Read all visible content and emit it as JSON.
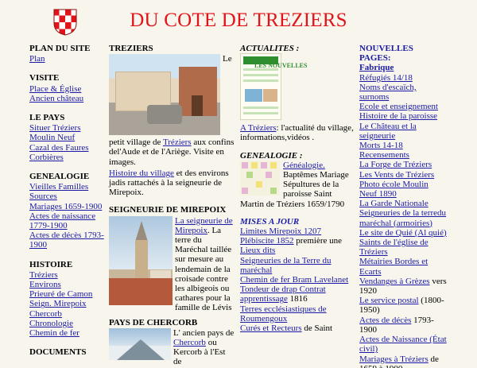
{
  "header": {
    "title": "DU COTE DE TREZIERS",
    "shield_colors": [
      "#e0141b",
      "#ffffff"
    ]
  },
  "col1": {
    "plan": {
      "heading": "PLAN DU SITE",
      "links": [
        "Plan"
      ]
    },
    "visite": {
      "heading": "VISITE",
      "links": [
        "Place & Église",
        "Ancien château"
      ]
    },
    "pays": {
      "heading": "LE PAYS",
      "links": [
        "Situer Tréziers",
        "Moulin Neuf",
        "Cazal des Faures",
        "Corbières"
      ]
    },
    "genealogie": {
      "heading": "GENEALOGIE",
      "links": [
        "Vieilles Familles",
        "Sources",
        "Mariages 1659-1900",
        "Actes de naissance 1779-1900",
        "Actes de décès 1793-1900"
      ]
    },
    "histoire": {
      "heading": "HISTOIRE",
      "links": [
        "Tréziers",
        "Environs",
        "Prieuré de Camon",
        "Seign. Mirepoix",
        "Chercorb",
        "Chronologie",
        "Chemin de fer"
      ]
    },
    "documents": {
      "heading": "DOCUMENTS"
    }
  },
  "col2": {
    "treziers": {
      "heading": "TREZIERS",
      "text_le": "Le",
      "text_petit": "petit village de",
      "link_treziers": "Tréziers",
      "text_confins": "aux confins del'Aude et de l'Ariège. Visite en images.",
      "link_histoire": "Histoire du village",
      "text_environs": "et des environs jadis rattachés à la seigneurie de Mirepoix."
    },
    "seigneurie": {
      "heading": "SEIGNEURIE DE MIREPOIX",
      "link": "La seigneurie de Mirepoix",
      "text": ". La terre du Maréchal taillée sur mesure au lendemain de la croisade contre les albigeois ou cathares pour la famille de Lévis"
    },
    "chercorb": {
      "heading": "PAYS DE CHERCORB",
      "text_1": "L' ancien pays de",
      "link": "Chercorb",
      "text_2": "ou Kercorb à l'Est de"
    }
  },
  "col3": {
    "actualites": {
      "heading": "ACTUALITES :",
      "news_label": "LES NOUVELLES",
      "link": "A Tréziers",
      "text": ": l'actualité du village, informations,vidéos ."
    },
    "genealogie": {
      "heading": "GENEALOGIE :",
      "link": "Généalogie.",
      "text": "Baptêmes Mariage Sépultures de la paroisse Saint Martin de Tréziers 1659/1790"
    },
    "mises_a_jour": {
      "heading": "MISES A JOUR",
      "items": [
        {
          "link": "Limites Mirepoix 1207",
          "text": ""
        },
        {
          "link": "Plébiscite 1852",
          "text": " première une"
        },
        {
          "link": "Lieux dits",
          "text": ""
        },
        {
          "link": "Seigneuries de la Terre du maréchal",
          "text": ""
        },
        {
          "link": "Chemin de fer Bram Lavelanet",
          "text": ""
        },
        {
          "link": "Tondeur de drap Contrat apprentissage",
          "text": " 1816"
        },
        {
          "link": "Terres ecclésiastiques de Roumengoux",
          "text": ""
        },
        {
          "link": "Curés et Recteurs",
          "text": " de Saint"
        }
      ]
    }
  },
  "col4": {
    "heading": "NOUVELLES PAGES:",
    "subheading": "Fabrique",
    "items": [
      {
        "link": "Réfugiés 14/18",
        "text": ""
      },
      {
        "link": "Noms d'escaïch, surnoms",
        "text": ""
      },
      {
        "link": "Ecole et enseignement",
        "text": ""
      },
      {
        "link": "Histoire de la paroisse",
        "text": ""
      },
      {
        "link": "Le Château et la seigneurie",
        "text": ""
      },
      {
        "link": "Morts 14-18",
        "text": ""
      },
      {
        "link": "Recensements",
        "text": ""
      },
      {
        "link": "La Forge de Tréziers",
        "text": ""
      },
      {
        "link": "Les Vents de Tréziers",
        "text": ""
      },
      {
        "link": "Photo école Moulin Neuf 1890",
        "text": ""
      },
      {
        "link": "La Garde Nationale",
        "text": ""
      },
      {
        "link": "Seigneuries de la terredu maréchal (armoiries)",
        "text": ""
      },
      {
        "link": "Le site de Quié (Al quié)",
        "text": ""
      },
      {
        "link": "Saints de l'église de Tréziers",
        "text": ""
      },
      {
        "link": "Métairies Bordes et Ecarts",
        "text": ""
      },
      {
        "link": "Vendanges à Grèzes",
        "text": " vers 1920"
      },
      {
        "link": "Le service postal",
        "text": " (1800-1950)"
      },
      {
        "link": "Actes de décès",
        "text": " 1793-1900"
      },
      {
        "link": "Actes de Naissance (État civil)",
        "text": ""
      },
      {
        "link": "Mariages à Tréziers",
        "text": " de 1659 à 1900"
      }
    ]
  }
}
